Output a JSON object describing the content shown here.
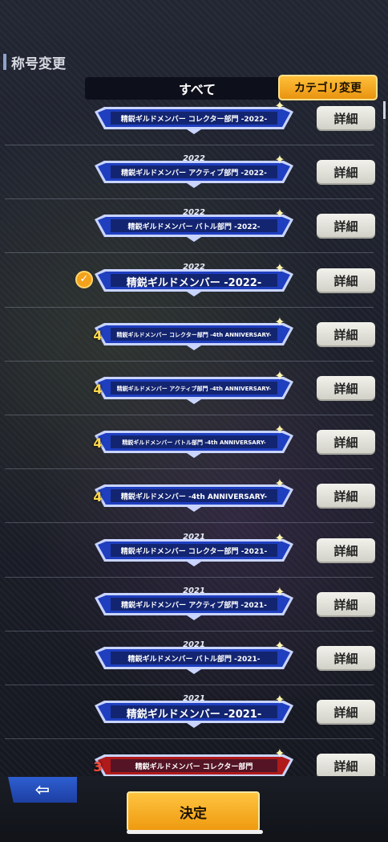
{
  "header": {
    "title": "称号変更",
    "filter_label": "すべて",
    "category_button": "カテゴリ変更"
  },
  "titles": [
    {
      "year": "",
      "text": "精鋭ギルドメンバー コレクター部門 -2022-",
      "size": "normal",
      "badge": "",
      "selected": false
    },
    {
      "year": "2022",
      "text": "精鋭ギルドメンバー アクティブ部門 -2022-",
      "size": "normal",
      "badge": "",
      "selected": false
    },
    {
      "year": "2022",
      "text": "精鋭ギルドメンバー バトル部門 -2022-",
      "size": "normal",
      "badge": "",
      "selected": false
    },
    {
      "year": "2022",
      "text": "精鋭ギルドメンバー -2022-",
      "size": "big",
      "badge": "",
      "selected": true
    },
    {
      "year": "",
      "text": "精鋭ギルドメンバー コレクター部門 -4th ANNIVERSARY-",
      "size": "mini",
      "badge": "4",
      "selected": false
    },
    {
      "year": "",
      "text": "精鋭ギルドメンバー アクティブ部門 -4th ANNIVERSARY-",
      "size": "mini",
      "badge": "4",
      "selected": false
    },
    {
      "year": "",
      "text": "精鋭ギルドメンバー バトル部門 -4th ANNIVERSARY-",
      "size": "mini",
      "badge": "4",
      "selected": false
    },
    {
      "year": "",
      "text": "精鋭ギルドメンバー -4th ANNIVERSARY-",
      "size": "normal",
      "badge": "4",
      "selected": false
    },
    {
      "year": "2021",
      "text": "精鋭ギルドメンバー コレクター部門 -2021-",
      "size": "normal",
      "badge": "",
      "selected": false
    },
    {
      "year": "2021",
      "text": "精鋭ギルドメンバー アクティブ部門 -2021-",
      "size": "normal",
      "badge": "",
      "selected": false
    },
    {
      "year": "2021",
      "text": "精鋭ギルドメンバー バトル部門 -2021-",
      "size": "normal",
      "badge": "",
      "selected": false
    },
    {
      "year": "2021",
      "text": "精鋭ギルドメンバー -2021-",
      "size": "big",
      "badge": "",
      "selected": false
    },
    {
      "year": "",
      "text": "精鋭ギルドメンバー コレクター部門",
      "size": "normal",
      "badge": "3",
      "selected": false
    }
  ],
  "detail_label": "詳細",
  "footer": {
    "back_icon": "arrow-left-icon",
    "back_glyph": "⇦",
    "decide_label": "決定"
  },
  "colors": {
    "plate_blue": "#1f3fbf",
    "plate_red": "#b01a1a",
    "accent_orange": "#f3a21b"
  }
}
